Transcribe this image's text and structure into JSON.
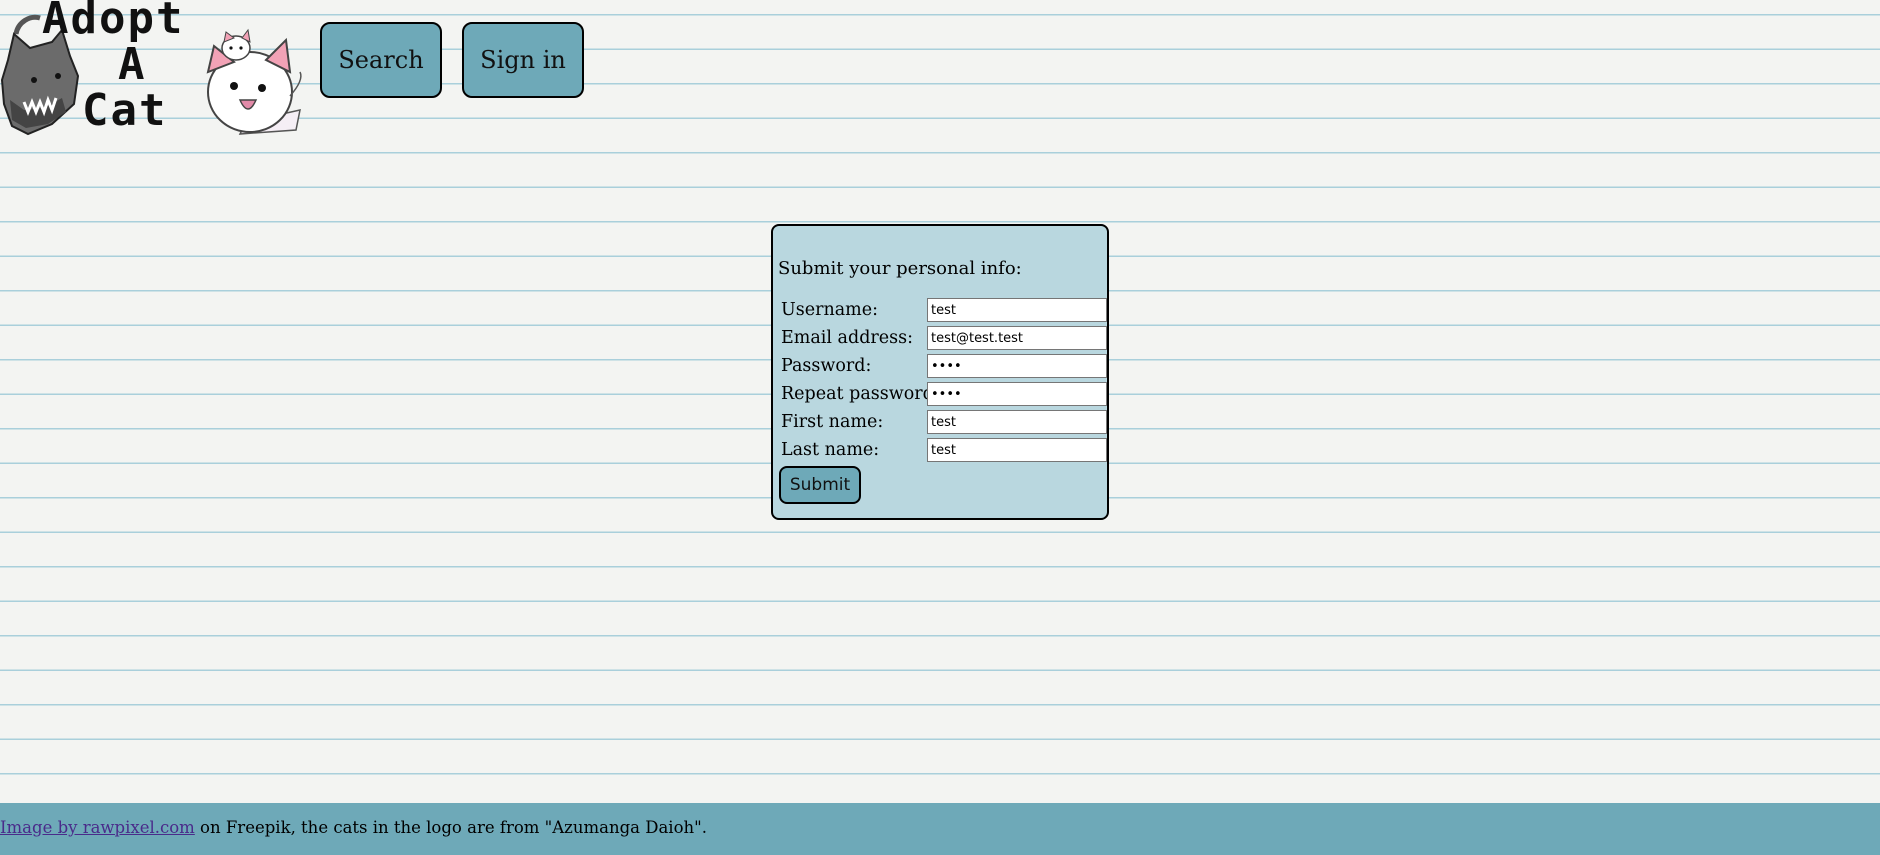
{
  "header": {
    "logo_lines": [
      "Adopt",
      "A",
      "Cat"
    ],
    "nav": {
      "search_label": "Search",
      "signin_label": "Sign in"
    }
  },
  "form": {
    "title": "Submit your personal info:",
    "fields": [
      {
        "label": "Username:",
        "value": "test",
        "type": "text"
      },
      {
        "label": "Email address:",
        "value": "test@test.test",
        "type": "text"
      },
      {
        "label": "Password:",
        "value": "test",
        "type": "password"
      },
      {
        "label": "Repeat password:",
        "value": "test",
        "type": "password"
      },
      {
        "label": "First name:",
        "value": "test",
        "type": "text"
      },
      {
        "label": "Last name:",
        "value": "test",
        "type": "text"
      }
    ],
    "submit_label": "Submit"
  },
  "footer": {
    "link_text": "Image by rawpixel.com",
    "rest_text": " on Freepik, the cats in the logo are from \"Azumanga Daioh\"."
  },
  "colors": {
    "page_bg": "#f3f4f2",
    "rule_line": "#a9cfdb",
    "accent": "#6ea9b8",
    "panel_bg": "#b9d7df"
  },
  "icons": {
    "logo_left": "grey-cat-icon",
    "logo_right": "white-cat-icon"
  }
}
